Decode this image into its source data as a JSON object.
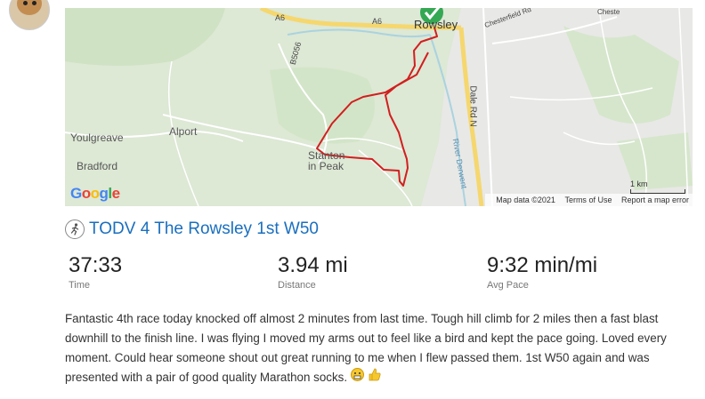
{
  "map": {
    "places": {
      "youlgreave": "Youlgreave",
      "alport": "Alport",
      "bradford": "Bradford",
      "stanton": "Stanton",
      "stanton2": "in Peak",
      "rowsley": "Rowsley"
    },
    "roads": {
      "a6_left": "A6",
      "a6_right": "A6",
      "b5056": "B5056",
      "dale_rd": "Dale Rd N",
      "river": "River Derwent",
      "chesterfield_rd": "Chesterfield Rd",
      "chester": "Cheste"
    },
    "google_letters": [
      "G",
      "o",
      "o",
      "g",
      "l",
      "e"
    ],
    "google_colors": [
      "#4285f4",
      "#ea4335",
      "#fbbc05",
      "#4285f4",
      "#34a853",
      "#ea4335"
    ],
    "attribution": {
      "data": "Map data ©2021",
      "terms": "Terms of Use",
      "report": "Report a map error"
    },
    "scale_label": "1 km",
    "route_color": "#d11f1f"
  },
  "activity": {
    "icon": "running-icon",
    "title": "TODV 4 The Rowsley 1st W50",
    "stats": [
      {
        "value": "37:33",
        "label": "Time"
      },
      {
        "value": "3.94 mi",
        "label": "Distance"
      },
      {
        "value": "9:32 min/mi",
        "label": "Avg Pace"
      }
    ],
    "description": "Fantastic 4th race today knocked off almost 2 minutes from last time. Tough hill climb for 2 miles then a fast blast downhill to the finish line. I was flying I moved my arms out to feel like a bird and kept the pace going. Loved every moment. Could hear someone shout out great running to me when I flew passed them. 1st W50 again and was presented with a pair of good quality Marathon socks."
  }
}
